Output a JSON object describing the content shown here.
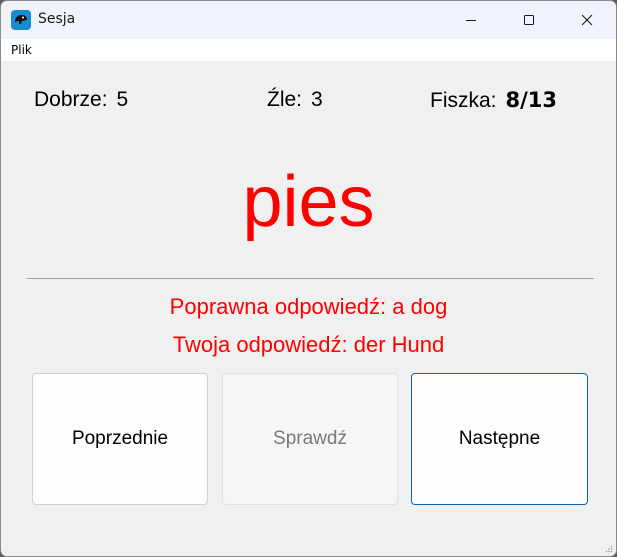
{
  "window": {
    "title": "Sesja",
    "icon": "app-icon"
  },
  "menu": {
    "items": [
      "Plik"
    ]
  },
  "stats": {
    "good_label": "Dobrze:",
    "good_value": "5",
    "bad_label": "Źle:",
    "bad_value": "3",
    "card_label": "Fiszka:",
    "card_value": "8/13"
  },
  "flashcard": {
    "word": "pies",
    "correct_answer": "Poprawna odpowiedź: a dog",
    "your_answer": "Twoja odpowiedź: der Hund"
  },
  "buttons": {
    "previous": "Poprzednie",
    "check": "Sprawdź",
    "next": "Następne"
  },
  "colors": {
    "feedback": "#ff0000",
    "focus_border": "#0a64b8"
  }
}
